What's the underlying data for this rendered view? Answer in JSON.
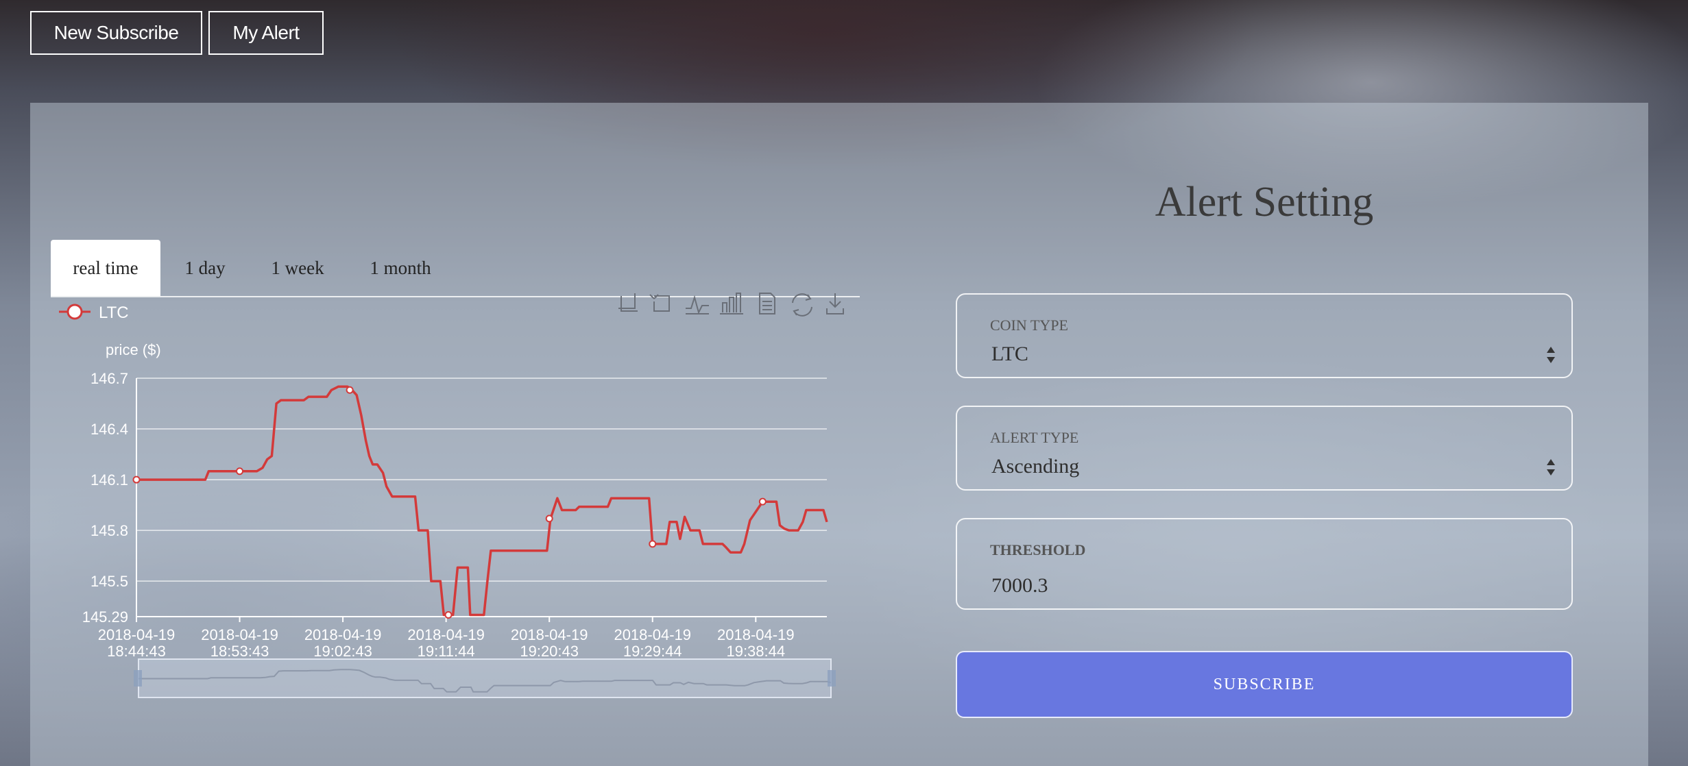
{
  "nav": {
    "new_subscribe": "New Subscribe",
    "my_alert": "My Alert"
  },
  "tabs": [
    {
      "label": "real time",
      "active": true
    },
    {
      "label": "1 day",
      "active": false
    },
    {
      "label": "1 week",
      "active": false
    },
    {
      "label": "1 month",
      "active": false
    }
  ],
  "toolbox_icons": [
    "zoom-select-icon",
    "zoom-reset-icon",
    "line-chart-icon",
    "bar-chart-icon",
    "data-view-icon",
    "restore-icon",
    "save-image-icon"
  ],
  "chart_data": {
    "type": "line",
    "legend": [
      "LTC"
    ],
    "ylabel": "price ($)",
    "ylim": [
      145.29,
      146.7
    ],
    "y_ticks": [
      "146.7",
      "146.4",
      "146.1",
      "145.8",
      "145.5",
      "145.29"
    ],
    "x_ticks": [
      [
        "2018-04-19",
        "18:44:43"
      ],
      [
        "2018-04-19",
        "18:53:43"
      ],
      [
        "2018-04-19",
        "19:02:43"
      ],
      [
        "2018-04-19",
        "19:11:44"
      ],
      [
        "2018-04-19",
        "19:20:43"
      ],
      [
        "2018-04-19",
        "19:29:44"
      ],
      [
        "2018-04-19",
        "19:38:44"
      ]
    ],
    "x_minutes_range": [
      0,
      60.2
    ],
    "line_color": "#d33a3a",
    "series": [
      {
        "name": "LTC",
        "points": [
          [
            0,
            146.1
          ],
          [
            6,
            146.1
          ],
          [
            6.3,
            146.15
          ],
          [
            10.5,
            146.15
          ],
          [
            11,
            146.17
          ],
          [
            11.4,
            146.22
          ],
          [
            11.8,
            146.24
          ],
          [
            12.2,
            146.55
          ],
          [
            12.6,
            146.57
          ],
          [
            14.6,
            146.57
          ],
          [
            15,
            146.59
          ],
          [
            16.6,
            146.59
          ],
          [
            17,
            146.63
          ],
          [
            17.6,
            146.65
          ],
          [
            18.4,
            146.65
          ],
          [
            18.8,
            146.63
          ],
          [
            19.2,
            146.6
          ],
          [
            19.6,
            146.48
          ],
          [
            20,
            146.33
          ],
          [
            20.3,
            146.24
          ],
          [
            20.6,
            146.19
          ],
          [
            21,
            146.19
          ],
          [
            21.5,
            146.14
          ],
          [
            21.8,
            146.06
          ],
          [
            22.3,
            146.0
          ],
          [
            24.3,
            146.0
          ],
          [
            24.6,
            145.8
          ],
          [
            25.4,
            145.8
          ],
          [
            25.7,
            145.5
          ],
          [
            26.5,
            145.5
          ],
          [
            26.8,
            145.3
          ],
          [
            27.6,
            145.3
          ],
          [
            28,
            145.58
          ],
          [
            28.9,
            145.58
          ],
          [
            29.1,
            145.3
          ],
          [
            30.3,
            145.3
          ],
          [
            30.6,
            145.5
          ],
          [
            30.9,
            145.68
          ],
          [
            33.2,
            145.68
          ],
          [
            35.8,
            145.68
          ],
          [
            36.1,
            145.87
          ],
          [
            36.7,
            145.99
          ],
          [
            37.1,
            145.92
          ],
          [
            38.3,
            145.92
          ],
          [
            38.6,
            145.94
          ],
          [
            41.1,
            145.94
          ],
          [
            41.4,
            145.99
          ],
          [
            42.6,
            145.99
          ],
          [
            44.7,
            145.99
          ],
          [
            45,
            145.72
          ],
          [
            46.2,
            145.72
          ],
          [
            46.5,
            145.85
          ],
          [
            47.1,
            145.85
          ],
          [
            47.4,
            145.75
          ],
          [
            47.8,
            145.88
          ],
          [
            48.3,
            145.8
          ],
          [
            49.1,
            145.8
          ],
          [
            49.4,
            145.72
          ],
          [
            51.1,
            145.72
          ],
          [
            51.4,
            145.7
          ],
          [
            51.8,
            145.67
          ],
          [
            52.7,
            145.67
          ],
          [
            53,
            145.72
          ],
          [
            53.5,
            145.86
          ],
          [
            54,
            145.91
          ],
          [
            54.6,
            145.97
          ],
          [
            55.8,
            145.97
          ],
          [
            56.1,
            145.83
          ],
          [
            56.5,
            145.81
          ],
          [
            56.9,
            145.8
          ],
          [
            57.7,
            145.8
          ],
          [
            58.1,
            145.85
          ],
          [
            58.4,
            145.92
          ],
          [
            59.9,
            145.92
          ],
          [
            60.2,
            145.85
          ]
        ]
      }
    ]
  },
  "form": {
    "title": "Alert Setting",
    "coin_type_label": "COIN TYPE",
    "coin_type_value": "LTC",
    "alert_type_label": "ALERT TYPE",
    "alert_type_value": "Ascending",
    "threshold_label": "THRESHOLD",
    "threshold_value": "7000.3",
    "subscribe_label": "SUBSCRIBE"
  }
}
